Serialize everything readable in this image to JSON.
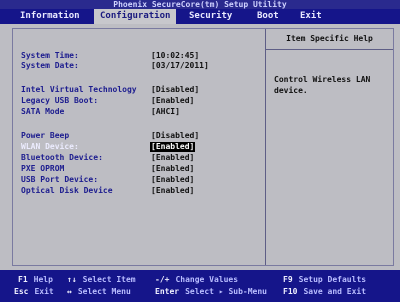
{
  "window": {
    "title": "Phoenix SecureCore(tm) Setup Utility"
  },
  "menu": [
    {
      "label": "Information"
    },
    {
      "label": "Configuration"
    },
    {
      "label": "Security"
    },
    {
      "label": "Boot"
    },
    {
      "label": "Exit"
    }
  ],
  "settings": {
    "system_time_label": "System Time:",
    "system_time_value": "[10:02:45]",
    "system_date_label": "System Date:",
    "system_date_value": "[03/17/2011]",
    "ivt_label": "Intel Virtual Technology",
    "ivt_value": "[Disabled]",
    "legacy_label": "Legacy USB Boot:",
    "legacy_value": "[Enabled]",
    "sata_label": "SATA Mode",
    "sata_value": "[AHCI]",
    "beep_label": "Power Beep",
    "beep_value": "[Disabled]",
    "wlan_label": "WLAN Device:",
    "wlan_value": "[Enabled]",
    "bt_label": "Bluetooth Device:",
    "bt_value": "[Enabled]",
    "pxe_label": "PXE OPROM",
    "pxe_value": "[Enabled]",
    "usb_label": "USB Port Device:",
    "usb_value": "[Enabled]",
    "odd_label": "Optical Disk Device",
    "odd_value": "[Enabled]"
  },
  "help": {
    "title": "Item Specific Help",
    "text": "Control Wireless LAN device."
  },
  "footer": {
    "f1_key": "F1",
    "f1_desc": "Help",
    "updown_key": "↑↓",
    "updown_desc": "Select Item",
    "pm_key": "-/+",
    "pm_desc": "Change Values",
    "f9_key": "F9",
    "f9_desc": "Setup Defaults",
    "esc_key": "Esc",
    "esc_desc": "Exit",
    "lr_key": "↔",
    "lr_desc": "Select Menu",
    "enter_key": "Enter",
    "enter_desc": "Select ▸ Sub-Menu",
    "f10_key": "F10",
    "f10_desc": "Save and Exit"
  }
}
